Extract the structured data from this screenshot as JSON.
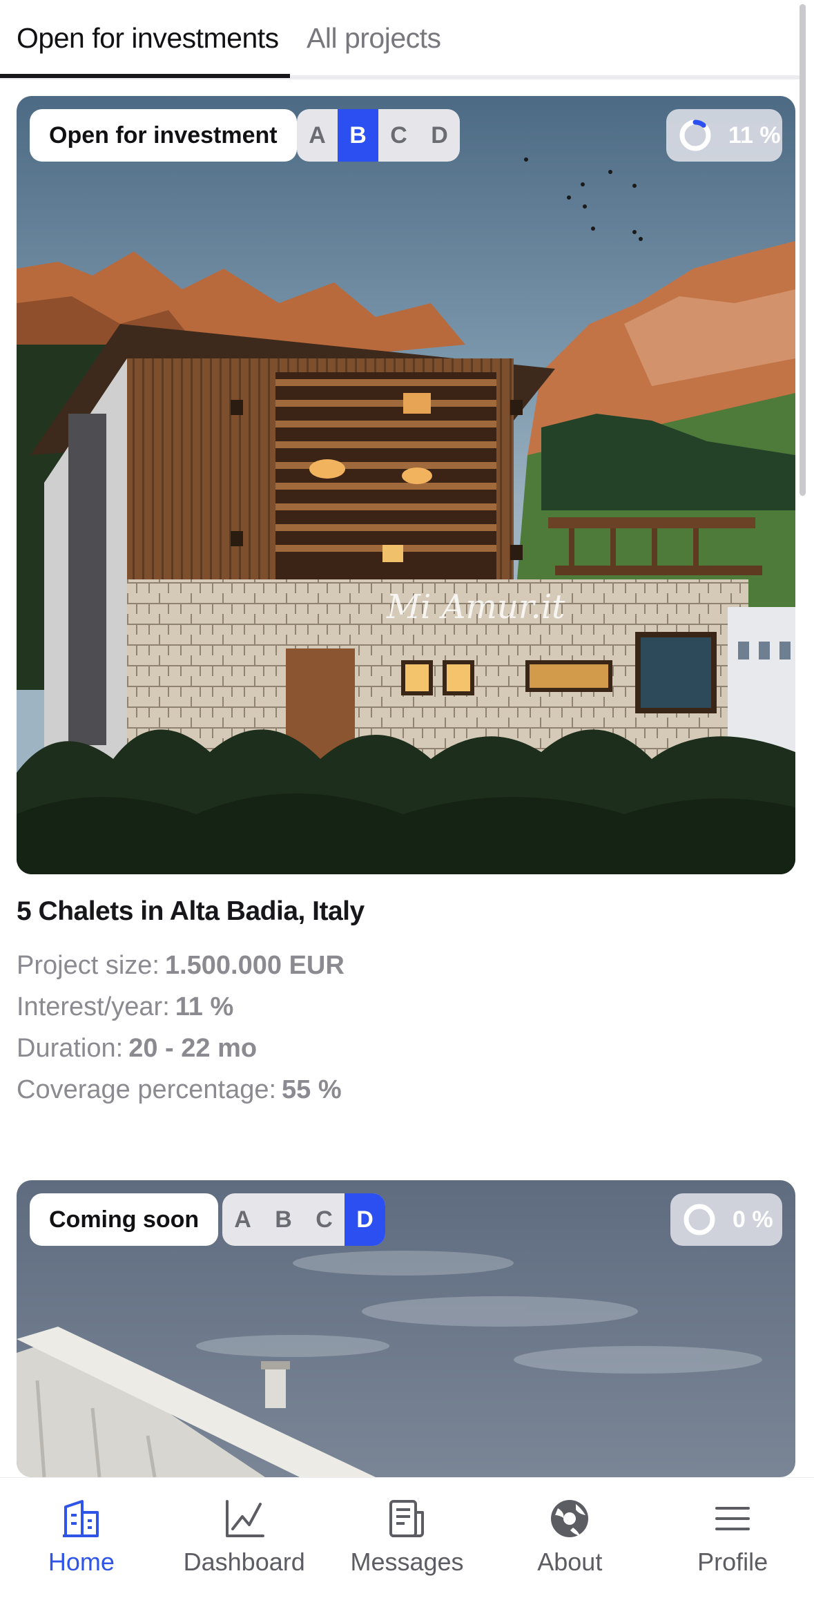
{
  "tabs": [
    {
      "label": "Open for investments",
      "active": true
    },
    {
      "label": "All projects",
      "active": false
    }
  ],
  "projects": [
    {
      "status": "Open for investment",
      "risk_classes": [
        "A",
        "B",
        "C",
        "D"
      ],
      "risk_selected": "B",
      "funded_percent_label": "11 %",
      "funded_fraction": 0.11,
      "watermark": "Mi Amur.it",
      "title": "5 Chalets in Alta Badia, Italy",
      "facts": [
        {
          "label": "Project size:",
          "value": "1.500.000 EUR"
        },
        {
          "label": "Interest/year:",
          "value": "11 %"
        },
        {
          "label": "Duration:",
          "value": "20 - 22 mo"
        },
        {
          "label": "Coverage percentage:",
          "value": "55 %"
        }
      ]
    },
    {
      "status": "Coming soon",
      "risk_classes": [
        "A",
        "B",
        "C",
        "D"
      ],
      "risk_selected": "D",
      "funded_percent_label": "0 %",
      "funded_fraction": 0.0
    }
  ],
  "nav": [
    {
      "label": "Home",
      "icon": "home-building-icon",
      "active": true
    },
    {
      "label": "Dashboard",
      "icon": "chart-line-icon",
      "active": false
    },
    {
      "label": "Messages",
      "icon": "document-messages-icon",
      "active": false
    },
    {
      "label": "About",
      "icon": "about-globe-icon",
      "active": false
    },
    {
      "label": "Profile",
      "icon": "menu-lines-icon",
      "active": false
    }
  ],
  "colors": {
    "accent": "#2b4ff0",
    "nav_active": "#2f55e8"
  }
}
